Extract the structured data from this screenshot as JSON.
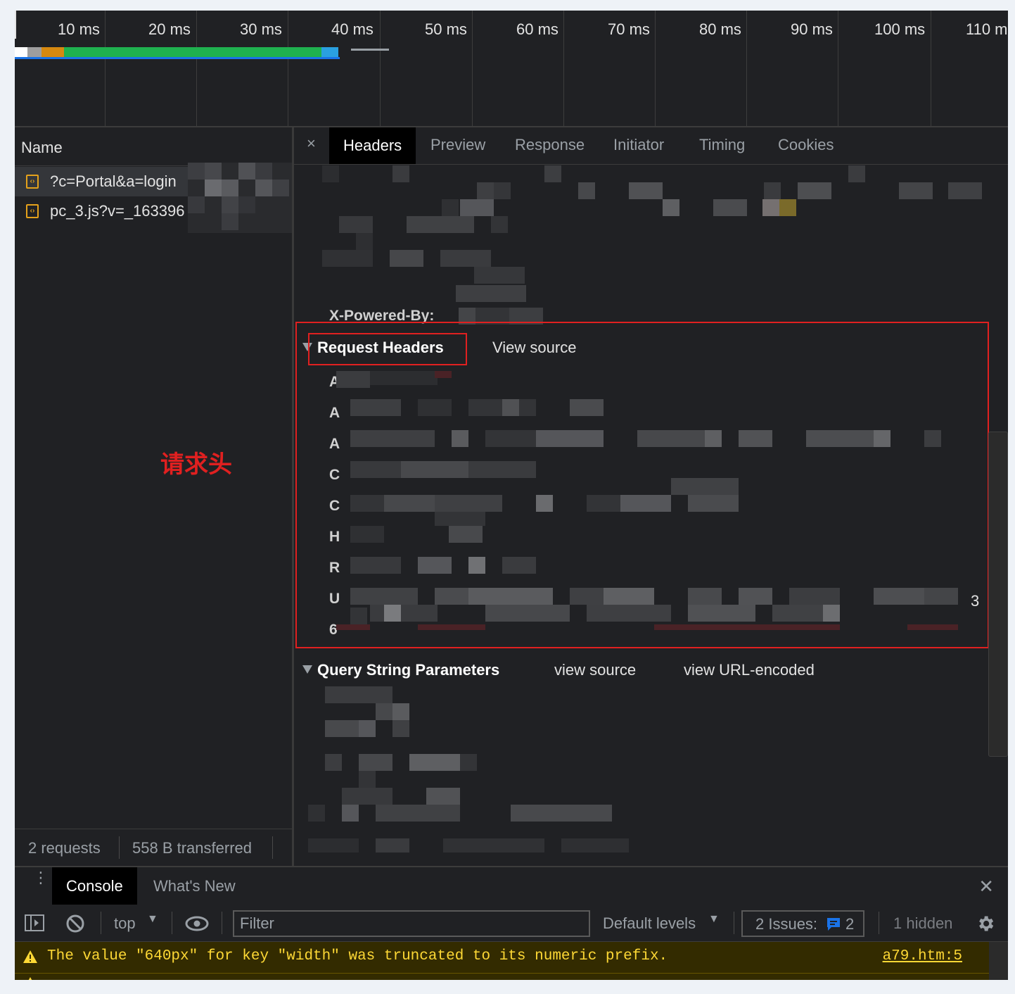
{
  "timeline": {
    "ticks": [
      "10 ms",
      "20 ms",
      "30 ms",
      "40 ms",
      "50 ms",
      "60 ms",
      "70 ms",
      "80 ms",
      "90 ms",
      "100 ms",
      "110 ms"
    ]
  },
  "requests": {
    "column_header": "Name",
    "items": [
      {
        "name": "?c=Portal&a=login"
      },
      {
        "name": "pc_3.js?v=_163396"
      }
    ],
    "status": {
      "count": "2 requests",
      "transferred": "558 B transferred"
    }
  },
  "detail": {
    "close_symbol": "×",
    "tabs": [
      "Headers",
      "Preview",
      "Response",
      "Initiator",
      "Timing",
      "Cookies"
    ],
    "active_tab": "Headers",
    "response_last_key": "X-Powered-By:",
    "request_headers": {
      "title": "Request Headers",
      "view_source": "View source",
      "visible_key_letters": [
        "A",
        "A",
        "A",
        "C",
        "C",
        "H",
        "R",
        "U",
        "6"
      ],
      "trailing_digit": "3"
    },
    "query_params": {
      "title": "Query String Parameters",
      "view_source": "view source",
      "view_url_encoded": "view URL-encoded"
    }
  },
  "annotation": {
    "label": "请求头",
    "color": "#e02020"
  },
  "drawer": {
    "tabs": [
      "Console",
      "What's New"
    ],
    "active_tab": "Console",
    "toolbar": {
      "context": "top",
      "filter_placeholder": "Filter",
      "levels": "Default levels",
      "issues_label": "2 Issues:",
      "issues_count": "2",
      "hidden": "1 hidden"
    },
    "messages": [
      {
        "level": "warning",
        "text": "The value \"640px\" for key \"width\" was truncated to its numeric prefix.",
        "source": "a79.htm:5"
      }
    ]
  },
  "colors": {
    "background": "#202124",
    "highlight_box": "#e02020",
    "warning_text": "#fdd835"
  }
}
